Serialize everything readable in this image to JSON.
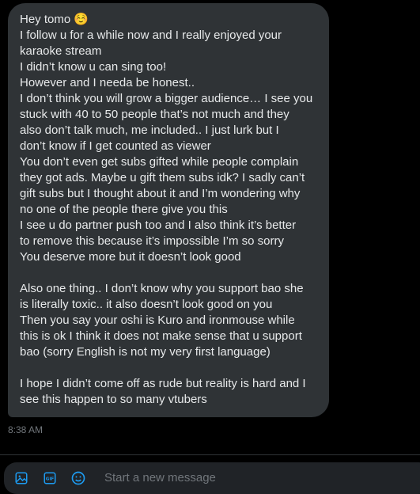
{
  "message": {
    "lines": [
      "Hey tomo ☺️",
      "I follow u for a while now and I really enjoyed your",
      "karaoke stream",
      "I didn’t know u can sing too!",
      "However and I needa be honest..",
      "I don’t think you will grow a bigger audience… I see you",
      "stuck with 40 to 50 people that’s not much and they",
      "also don’t talk much, me included.. I just lurk but I",
      "don’t know if I get counted as viewer",
      "You don’t even get subs gifted while people complain",
      "they got ads. Maybe u gift them subs idk? I sadly can’t",
      "gift subs but I thought about it and I’m wondering why",
      "no one of the people there give you this",
      "I see u do partner push too and I also think it’s better",
      "to remove this because it’s impossible I’m so sorry",
      "You deserve more but it doesn’t look good",
      "",
      "Also one thing.. I don’t know why you support bao she",
      "is literally toxic.. it also doesn’t look good on you",
      "Then you say your oshi is Kuro and ironmouse while",
      "this is ok I think it does not make sense that u support",
      "bao (sorry English is not my very first language)",
      "",
      "I hope I didn’t come off as rude but reality is hard and I",
      "see this happen to so many vtubers"
    ],
    "timestamp": "8:38 AM"
  },
  "composer": {
    "placeholder": "Start a new message",
    "icons": [
      "image-icon",
      "gif-icon",
      "emoji-icon"
    ]
  },
  "colors": {
    "background": "#000000",
    "bubble": "#2f3336",
    "text": "#e7e9ea",
    "muted": "#71767b",
    "accent": "#1d9bf0",
    "composer": "#202327"
  }
}
